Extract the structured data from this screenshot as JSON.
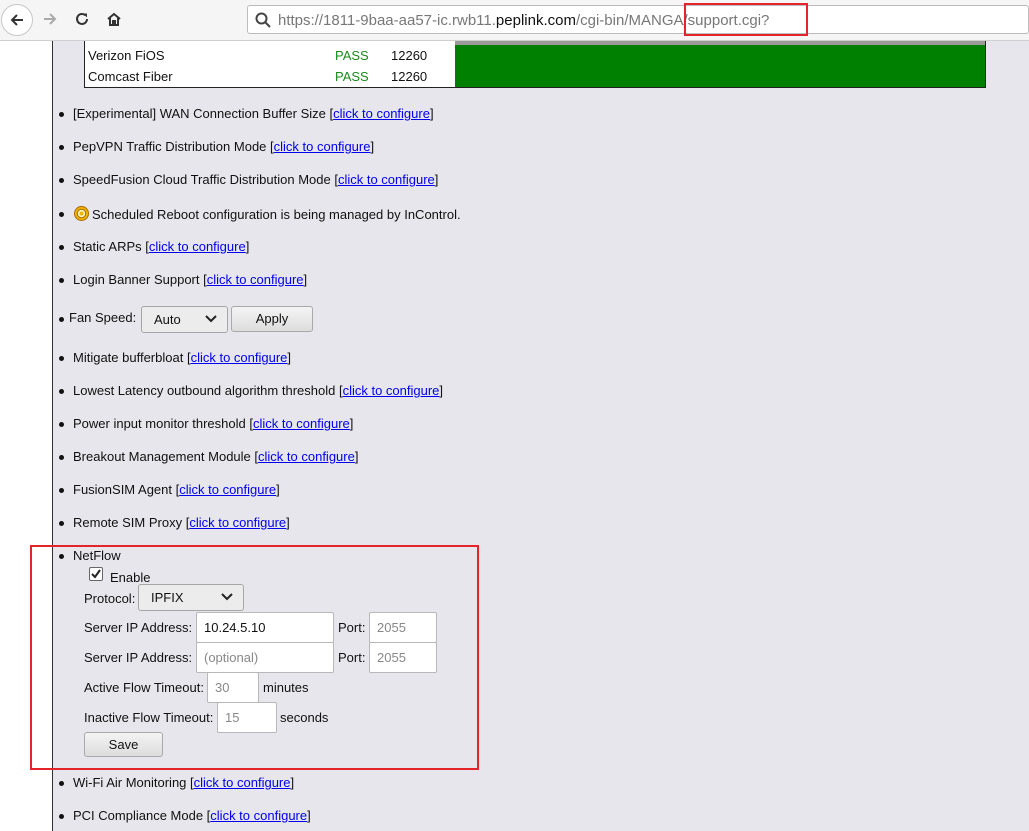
{
  "browser": {
    "url_prefix": "https://1811-9baa-aa57-ic.rwb11.",
    "url_domain": "peplink.com",
    "url_path": "/cgi-bin/MANGA/support.cgi?"
  },
  "wan_rows": [
    {
      "name": "Verizon FiOS",
      "status": "PASS",
      "value": "12260"
    },
    {
      "name": "Comcast Fiber",
      "status": "PASS",
      "value": "12260"
    }
  ],
  "link_text": "click to configure",
  "items": {
    "wan_buffer": "[Experimental] WAN Connection Buffer Size",
    "pepvpn_mode": "PepVPN Traffic Distribution Mode",
    "speedfusion_mode": "SpeedFusion Cloud Traffic Distribution Mode",
    "scheduled_reboot": "Scheduled Reboot configuration is being managed by InControl.",
    "static_arps": "Static ARPs",
    "login_banner": "Login Banner Support",
    "fan_speed_label": "Fan Speed:",
    "fan_speed_value": "Auto",
    "fan_apply": "Apply",
    "bufferbloat": "Mitigate bufferbloat",
    "lowest_latency": "Lowest Latency outbound algorithm threshold",
    "power_input": "Power input monitor threshold",
    "breakout": "Breakout Management Module",
    "fusionsim": "FusionSIM Agent",
    "remote_sim": "Remote SIM Proxy",
    "wifi_air": "Wi-Fi Air Monitoring",
    "pci": "PCI Compliance Mode"
  },
  "netflow": {
    "title": "NetFlow",
    "enable_label": "Enable",
    "enabled": true,
    "protocol_label": "Protocol:",
    "protocol_value": "IPFIX",
    "server1_label": "Server IP Address:",
    "server1_value": "10.24.5.10",
    "port1_label": "Port:",
    "port1_placeholder": "2055",
    "server2_label": "Server IP Address:",
    "server2_placeholder": "(optional)",
    "port2_label": "Port:",
    "port2_placeholder": "2055",
    "active_label": "Active Flow Timeout:",
    "active_placeholder": "30",
    "active_unit": "minutes",
    "inactive_label": "Inactive Flow Timeout:",
    "inactive_placeholder": "15",
    "inactive_unit": "seconds",
    "save_label": "Save"
  },
  "colors": {
    "highlight": "#e3252b",
    "pass": "#1a8a1a",
    "bar": "#008000",
    "link": "#0000ee"
  }
}
